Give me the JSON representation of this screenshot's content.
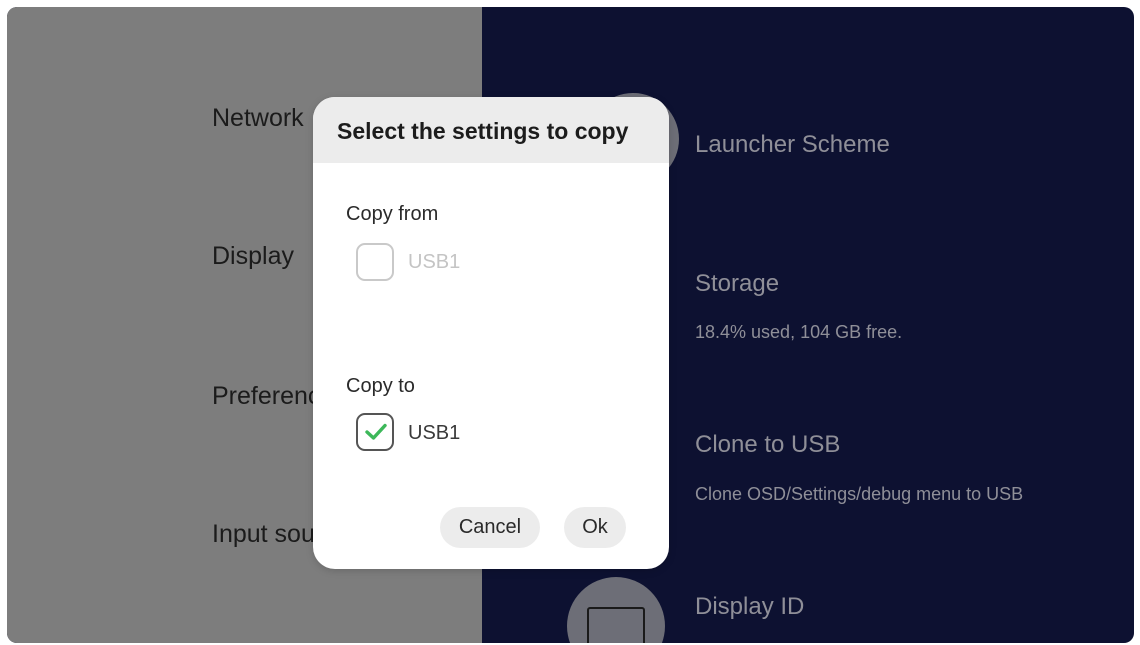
{
  "left_menu": {
    "items": [
      {
        "label": "Network"
      },
      {
        "label": "Display"
      },
      {
        "label": "Preferences"
      },
      {
        "label": "Input source"
      }
    ]
  },
  "right_panel": {
    "items": [
      {
        "title": "Launcher Scheme",
        "subtitle": ""
      },
      {
        "title": "Storage",
        "subtitle": "18.4% used, 104 GB free."
      },
      {
        "title": "Clone to USB",
        "subtitle": "Clone OSD/Settings/debug menu to USB"
      },
      {
        "title": "Display ID",
        "subtitle": ""
      }
    ],
    "icons": [
      "launcher-icon",
      "display-id-icon"
    ]
  },
  "dialog": {
    "title": "Select the settings to copy",
    "copy_from": {
      "label": "Copy from",
      "option": {
        "label": "USB1",
        "checked": false,
        "enabled": false
      }
    },
    "copy_to": {
      "label": "Copy to",
      "option": {
        "label": "USB1",
        "checked": true,
        "enabled": true
      }
    },
    "cancel_label": "Cancel",
    "ok_label": "Ok"
  },
  "colors": {
    "left_panel_bg": "#7d7d7d",
    "right_panel_bg": "#0d1131",
    "check_accent": "#3db85a",
    "dialog_header_bg": "#ececec"
  }
}
